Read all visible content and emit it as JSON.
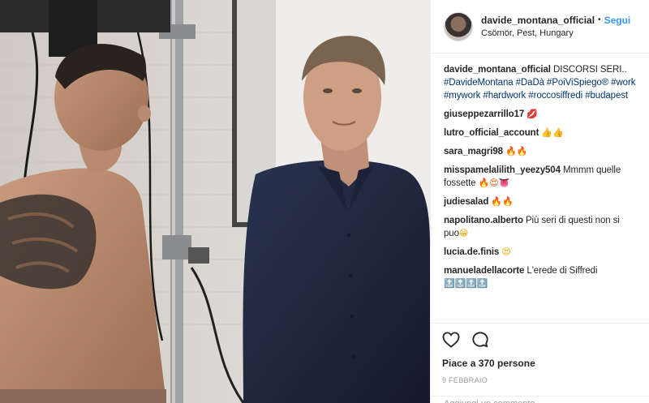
{
  "post": {
    "username": "davide_montana_official",
    "separator": "•",
    "follow_label": "Segui",
    "location": "Csömör, Pest, Hungary"
  },
  "caption": {
    "username": "davide_montana_official",
    "text": "DISCORSI SERI..",
    "hashtags_line1": "#DavideMontana #DaDà #PoiViSpiego®",
    "hashtags_line2": "#work #mywork #hardwork #roccosiffredi",
    "hashtags_line3": "#budapest"
  },
  "comments": [
    {
      "user": "giuseppezarrillo17",
      "text": "",
      "emoji": "💋"
    },
    {
      "user": "lutro_official_account",
      "text": "",
      "emoji": "👍👍"
    },
    {
      "user": "sara_magri98",
      "text": "",
      "emoji": "🔥🔥"
    },
    {
      "user": "misspamelalilith_yeezy504",
      "text": "Mmmm quelle fossette",
      "emoji": "🔥😍👅"
    },
    {
      "user": "judiesalad",
      "text": "",
      "emoji": "🔥🔥"
    },
    {
      "user": "napolitano.alberto",
      "text": "Più seri di questi non si puo",
      "emoji": "😁"
    },
    {
      "user": "lucia.de.finis",
      "text": "",
      "emoji": "😍"
    },
    {
      "user": "manueladellacorte",
      "text": "L'erede di Siffredi",
      "emoji": "🔝🔝🔝🔝"
    }
  ],
  "actions": {
    "like_icon": "heart-icon",
    "comment_icon": "comment-icon"
  },
  "likes_text": "Piace a 370 persone",
  "date_text": "9 FEBBRAIO",
  "add_comment_placeholder": "Aggiungi un commento...",
  "colors": {
    "link_blue": "#3897f0",
    "hashtag": "#003569",
    "text": "#262626",
    "muted": "#999999"
  }
}
